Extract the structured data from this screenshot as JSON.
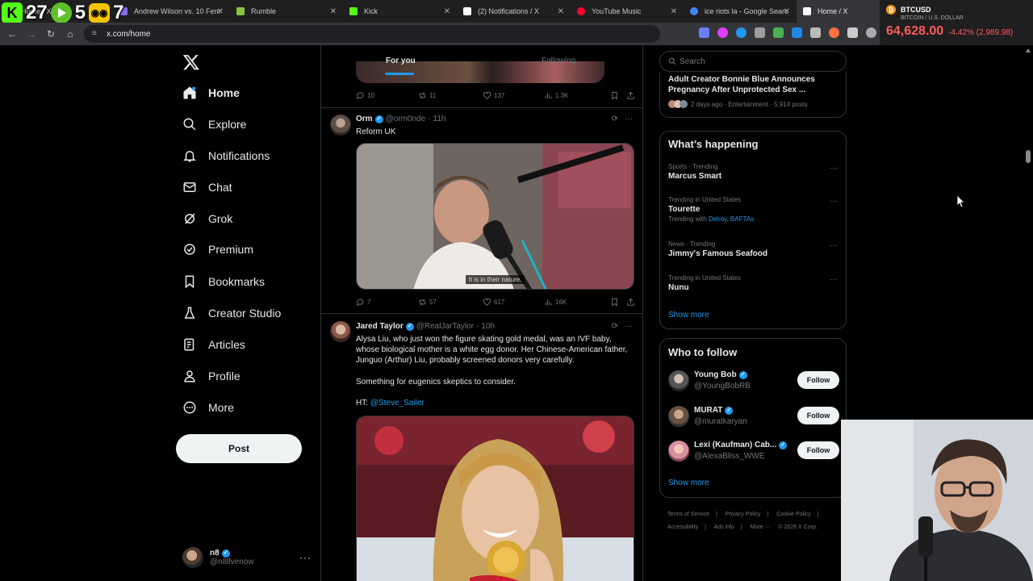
{
  "browser": {
    "tabs": [
      {
        "label": "Home / X",
        "color": "#ffffff"
      },
      {
        "label": "Andrew Wilson vs. 10 Fem",
        "color": "#8a6cff"
      },
      {
        "label": "Rumble",
        "color": "#85c742"
      },
      {
        "label": "Kick",
        "color": "#53fc18"
      },
      {
        "label": "(2) Notifications / X",
        "color": "#ffffff"
      },
      {
        "label": "YouTube Music",
        "color": "#ff0033"
      },
      {
        "label": "ice riots la - Google Searc",
        "color": "#4285f4"
      },
      {
        "label": "Home / X",
        "color": "#ffffff"
      }
    ],
    "url": "x.com/home",
    "overlay": {
      "kick_count": "27",
      "rumble_count": "5",
      "bot_count": "7"
    }
  },
  "ticker": {
    "symbol": "BTCUSD",
    "subtitle": "BITCOIN / U.S. DOLLAR",
    "price": "64,628.00",
    "change": "-4.42% (2,989.98)"
  },
  "nav": {
    "items": [
      {
        "label": "Home",
        "icon": "home-icon"
      },
      {
        "label": "Explore",
        "icon": "search-icon"
      },
      {
        "label": "Notifications",
        "icon": "bell-icon"
      },
      {
        "label": "Chat",
        "icon": "mail-icon"
      },
      {
        "label": "Grok",
        "icon": "grok-icon"
      },
      {
        "label": "Premium",
        "icon": "verified-icon"
      },
      {
        "label": "Bookmarks",
        "icon": "bookmark-icon"
      },
      {
        "label": "Creator Studio",
        "icon": "flask-icon"
      },
      {
        "label": "Articles",
        "icon": "article-icon"
      },
      {
        "label": "Profile",
        "icon": "person-icon"
      },
      {
        "label": "More",
        "icon": "more-circle-icon"
      }
    ],
    "post_label": "Post",
    "account": {
      "name": "n8",
      "handle": "@n8llvenow"
    }
  },
  "timeline": {
    "tabs": {
      "for_you": "For you",
      "following": "Following"
    },
    "prev_actions": {
      "replies": "10",
      "reposts": "11",
      "likes": "137",
      "views": "1.3K"
    },
    "tweets": [
      {
        "name": "Orm",
        "handle": "@orm0nde",
        "time": "11h",
        "text": "Reform UK",
        "caption": "It is in their nature.",
        "actions": {
          "replies": "7",
          "reposts": "57",
          "likes": "617",
          "views": "16K"
        }
      },
      {
        "name": "Jared Taylor",
        "handle": "@RealJarTaylor",
        "time": "10h",
        "text": "Alysa Liu, who just won the figure skating gold medal, was an IVF baby, whose biological mother is a white egg donor. Her Chinese-American father, Junguo (Arthur) Liu, probably screened donors very carefully.",
        "text2": "Something for eugenics skeptics to consider.",
        "ht_prefix": "HT: ",
        "ht_link": "@Steve_Sailer"
      }
    ]
  },
  "sidebar": {
    "search_placeholder": "Search",
    "top_story": {
      "title": "Adult Creator Bonnie Blue Announces Pregnancy After Unprotected Sex ...",
      "meta": "2 days ago · Entertainment · 5,914 posts"
    },
    "happening": {
      "title": "What’s happening",
      "trends": [
        {
          "meta": "Sports · Trending",
          "name": "Marcus Smart",
          "extra_prefix": "",
          "extra_links": ""
        },
        {
          "meta": "Trending in United States",
          "name": "Tourette",
          "extra_prefix": "Trending with ",
          "extra_links": "Delroy, BAFTAs"
        },
        {
          "meta": "News · Trending",
          "name": "Jimmy's Famous Seafood",
          "extra_prefix": "",
          "extra_links": ""
        },
        {
          "meta": "Trending in United States",
          "name": "Nunu",
          "extra_prefix": "",
          "extra_links": ""
        }
      ],
      "show_more": "Show more"
    },
    "who_to_follow": {
      "title": "Who to follow",
      "accounts": [
        {
          "name": "Young Bob",
          "handle": "@YoungBobRB"
        },
        {
          "name": "MURAT",
          "handle": "@muratkaryan"
        },
        {
          "name": "Lexi (Kaufman) Cab...",
          "handle": "@AlexaBliss_WWE"
        }
      ],
      "follow_label": "Follow",
      "show_more": "Show more"
    },
    "footer": [
      "Terms of Service",
      "|",
      "Privacy Policy",
      "|",
      "Cookie Policy",
      "|",
      "Accessibility",
      "|",
      "Ads info",
      "|",
      "More ···",
      "© 2026 X Corp."
    ]
  }
}
